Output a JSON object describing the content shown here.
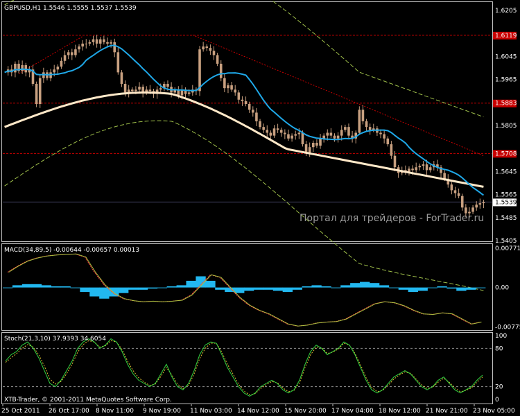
{
  "header": {
    "title": "GBPUSD,H1  1.5546 1.5555 1.5537 1.5539",
    "watermark": "Портал для трейдеров - ForTrader.ru",
    "copyright": "XTB-Trader, © 2001-2011 MetaQuotes Software Corp."
  },
  "colors": {
    "background": "#000000",
    "frame": "#c0c0c0",
    "candle": "#c8a080",
    "ma_fast": "#1fa8e8",
    "ma_slow": "#ffe8c8",
    "envelope": "#9fbf4a",
    "resistance": "#c80000",
    "trendline": "#c80000",
    "macd_hist": "#22b8f0",
    "macd_signal": "#ff4040",
    "macd_line": "#a8c040",
    "stoch_main": "#30d040",
    "stoch_signal": "#e0c030",
    "stoch_level": "#909090",
    "price_tag_bg": "#ffffff"
  },
  "chart_data": [
    {
      "type": "candlestick",
      "title": "GBPUSD,H1  1.5546 1.5555 1.5537 1.5539",
      "ylim": [
        1.5405,
        1.6232
      ],
      "y_ticks": [
        1.6205,
        1.6045,
        1.5965,
        1.5805,
        1.5645,
        1.5565,
        1.5485,
        1.5405
      ],
      "x_labels": [
        "25 Oct 2011",
        "26 Oct 17:00",
        "8 Nov 11:00",
        "9 Nov 19:00",
        "11 Nov 03:00",
        "14 Nov 12:00",
        "15 Nov 20:00",
        "17 Nov 04:00",
        "18 Nov 12:00",
        "21 Nov 21:00",
        "23 Nov 05:00"
      ],
      "price_path": [
        1.599,
        1.6,
        1.599,
        1.602,
        1.5995,
        1.6015,
        1.599,
        1.6,
        1.595,
        1.588,
        1.597,
        1.599,
        1.597,
        1.599,
        1.6,
        1.601,
        1.603,
        1.605,
        1.606,
        1.605,
        1.607,
        1.608,
        1.609,
        1.609,
        1.6095,
        1.6105,
        1.609,
        1.6105,
        1.6095,
        1.609,
        1.6095,
        1.606,
        1.599,
        1.595,
        1.592,
        1.593,
        1.5925,
        1.593,
        1.594,
        1.592,
        1.593,
        1.5925,
        1.5915,
        1.593,
        1.5935,
        1.595,
        1.594,
        1.592,
        1.593,
        1.591,
        1.593,
        1.5915,
        1.592,
        1.593,
        1.5925,
        1.607,
        1.608,
        1.6075,
        1.6065,
        1.605,
        1.602,
        1.597,
        1.5935,
        1.5945,
        1.593,
        1.592,
        1.5895,
        1.589,
        1.588,
        1.586,
        1.585,
        1.582,
        1.58,
        1.579,
        1.578,
        1.577,
        1.5795,
        1.579,
        1.578,
        1.5775,
        1.576,
        1.577,
        1.5775,
        1.578,
        1.574,
        1.571,
        1.573,
        1.5745,
        1.5735,
        1.576,
        1.577,
        1.578,
        1.577,
        1.576,
        1.577,
        1.579,
        1.58,
        1.577,
        1.576,
        1.578,
        1.586,
        1.582,
        1.58,
        1.579,
        1.5795,
        1.578,
        1.5775,
        1.576,
        1.574,
        1.57,
        1.566,
        1.564,
        1.565,
        1.5645,
        1.5655,
        1.565,
        1.566,
        1.5665,
        1.567,
        1.565,
        1.566,
        1.567,
        1.566,
        1.564,
        1.562,
        1.56,
        1.558,
        1.557,
        1.556,
        1.552,
        1.55,
        1.5505,
        1.552,
        1.553,
        1.5535,
        1.5539
      ],
      "resistance_levels": [
        {
          "price": 1.6119,
          "label": "1.6119"
        },
        {
          "price": 1.5883,
          "label": "1.5883"
        },
        {
          "price": 1.5708,
          "label": "1.5708"
        }
      ],
      "current_price": {
        "price": 1.5539,
        "label": "1.5539"
      }
    },
    {
      "type": "macd",
      "title": "MACD(34,89,5) -0.00644 -0.00657 0.00013",
      "ylim": [
        -0.0081,
        0.008
      ],
      "y_ticks": [
        0.00771,
        0.0,
        -0.00775
      ],
      "y_tick_labels": [
        "0.00771",
        "0.00",
        "-0.00775"
      ],
      "macd_line": [
        0.003,
        0.0042,
        0.0052,
        0.0058,
        0.0062,
        0.0064,
        0.0065,
        0.0066,
        0.006,
        0.003,
        0.0005,
        -0.0012,
        -0.0022,
        -0.0026,
        -0.0028,
        -0.0027,
        -0.0028,
        -0.0027,
        -0.0025,
        -0.0015,
        0.0005,
        0.0025,
        0.002,
        0.0,
        -0.002,
        -0.0035,
        -0.0045,
        -0.0052,
        -0.0062,
        -0.0072,
        -0.0076,
        -0.0074,
        -0.007,
        -0.0068,
        -0.0067,
        -0.0062,
        -0.0052,
        -0.0042,
        -0.0032,
        -0.0028,
        -0.003,
        -0.0036,
        -0.0045,
        -0.0052,
        -0.0053,
        -0.005,
        -0.0052,
        -0.0062,
        -0.0072,
        -0.0068
      ],
      "histogram": [
        0.0,
        0.0002,
        0.0003,
        0.0003,
        0.0002,
        0.0001,
        0.0001,
        0.0,
        -0.0004,
        -0.0008,
        -0.001,
        -0.0008,
        -0.0005,
        -0.0002,
        -0.0002,
        -0.0001,
        0.0,
        0.0001,
        0.0002,
        0.0006,
        0.001,
        0.0006,
        -0.0002,
        -0.0004,
        -0.0005,
        -0.0003,
        -0.0002,
        -0.0002,
        -0.0003,
        -0.0004,
        -0.0002,
        0.0001,
        0.0002,
        0.0001,
        0.0,
        0.0002,
        0.0004,
        0.0005,
        0.0004,
        0.0002,
        0.0,
        -0.0002,
        -0.0004,
        -0.0003,
        0.0,
        0.0001,
        -0.0001,
        -0.0003,
        -0.0002,
        0.0
      ]
    },
    {
      "type": "stochastic",
      "title": "Stoch(21,3,10) 37.9393 34.6054",
      "ylim": [
        0,
        100
      ],
      "y_ticks": [
        100,
        80,
        20,
        0
      ],
      "levels": [
        80,
        20
      ],
      "main": [
        60,
        70,
        75,
        85,
        90,
        80,
        65,
        45,
        25,
        20,
        30,
        45,
        60,
        80,
        90,
        95,
        90,
        80,
        85,
        95,
        90,
        75,
        55,
        40,
        30,
        25,
        20,
        25,
        40,
        55,
        35,
        20,
        15,
        25,
        45,
        70,
        85,
        90,
        88,
        70,
        50,
        35,
        20,
        10,
        5,
        10,
        20,
        25,
        30,
        25,
        15,
        10,
        15,
        30,
        55,
        75,
        85,
        80,
        70,
        75,
        80,
        90,
        85,
        70,
        50,
        30,
        15,
        10,
        15,
        25,
        35,
        40,
        45,
        40,
        30,
        20,
        15,
        20,
        30,
        35,
        25,
        15,
        10,
        15,
        20,
        30,
        38
      ],
      "signal": [
        58,
        65,
        72,
        80,
        86,
        82,
        70,
        52,
        32,
        24,
        28,
        40,
        55,
        74,
        86,
        92,
        90,
        82,
        84,
        92,
        90,
        78,
        60,
        45,
        34,
        27,
        22,
        24,
        36,
        50,
        38,
        24,
        17,
        22,
        40,
        64,
        80,
        88,
        88,
        74,
        55,
        40,
        24,
        13,
        7,
        9,
        17,
        23,
        28,
        26,
        18,
        12,
        14,
        26,
        50,
        70,
        82,
        81,
        72,
        74,
        79,
        88,
        85,
        72,
        54,
        34,
        19,
        12,
        14,
        22,
        32,
        38,
        43,
        41,
        32,
        23,
        17,
        19,
        27,
        33,
        27,
        18,
        12,
        14,
        18,
        27,
        35
      ]
    }
  ]
}
